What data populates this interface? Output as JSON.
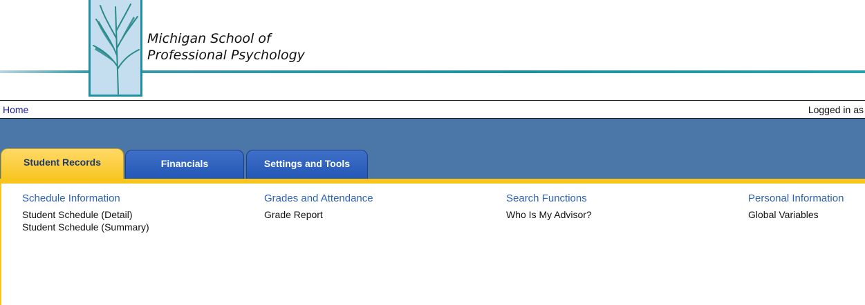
{
  "header": {
    "school_name_line1": "Michigan School of",
    "school_name_line2": "Professional Psychology"
  },
  "breadcrumb": {
    "home": "Home",
    "login_status": "Logged in as"
  },
  "tabs": [
    {
      "label": "Student Records",
      "active": true
    },
    {
      "label": "Financials",
      "active": false
    },
    {
      "label": "Settings and Tools",
      "active": false
    }
  ],
  "sections": [
    {
      "heading": "Schedule Information",
      "links": [
        "Student Schedule (Detail)",
        "Student Schedule (Summary)"
      ]
    },
    {
      "heading": "Grades and Attendance",
      "links": [
        "Grade Report"
      ]
    },
    {
      "heading": "Search Functions",
      "links": [
        "Who Is My Advisor?"
      ]
    },
    {
      "heading": "Personal Information",
      "links": [
        "Global Variables"
      ]
    }
  ],
  "colors": {
    "nav_band": "#4a76a8",
    "tab_active": "#f7c51e",
    "tab_inactive": "#2357b6",
    "section_heading": "#2b5fb0",
    "brand_teal": "#1e8f9c"
  },
  "icons": {
    "logo": "grass-plant-logo-icon"
  }
}
